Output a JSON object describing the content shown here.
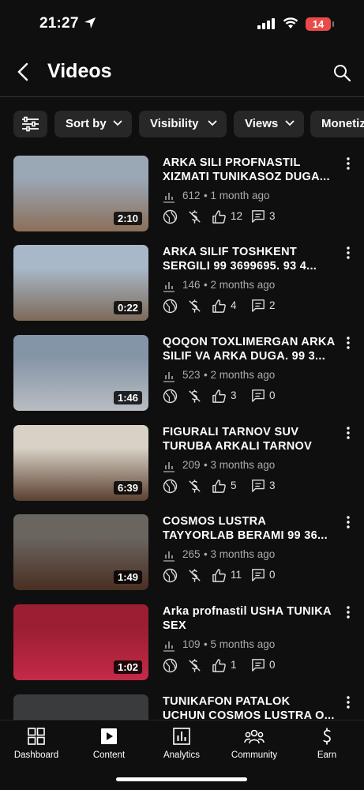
{
  "status": {
    "time": "21:27",
    "battery": "14"
  },
  "header": {
    "title": "Videos"
  },
  "filters": [
    {
      "label": "Sort by"
    },
    {
      "label": "Visibility"
    },
    {
      "label": "Views"
    },
    {
      "label": "Monetiz"
    }
  ],
  "videos": [
    {
      "title": "ARKA SILI PROFNASTIL\nXIZMATI TUNIKASOZ DUGA...",
      "duration": "2:10",
      "views": "612",
      "age": "1 month ago",
      "likes": "12",
      "comments": "3",
      "thumb_colors": [
        "#9aa7b5",
        "#8c6f5a"
      ]
    },
    {
      "title": "ARKA SILIF TOSHKENT\nSERGILI 99 3699695. 93 4...",
      "duration": "0:22",
      "views": "146",
      "age": "2 months ago",
      "likes": "4",
      "comments": "2",
      "thumb_colors": [
        "#a9b8c9",
        "#7d6a58"
      ]
    },
    {
      "title": "QOQON TOXLIMERGAN ARKA\nSILIF VA ARKA DUGA. 99 3...",
      "duration": "1:46",
      "views": "523",
      "age": "2 months ago",
      "likes": "3",
      "comments": "0",
      "thumb_colors": [
        "#8595a8",
        "#b9bdc2"
      ]
    },
    {
      "title": "FIGURALI TARNOV SUV\nTURUBA ARKALI TARNOV",
      "duration": "6:39",
      "views": "209",
      "age": "3 months ago",
      "likes": "5",
      "comments": "3",
      "thumb_colors": [
        "#d8d2c6",
        "#5a4030"
      ]
    },
    {
      "title": "COSMOS LUSTRA\nTAYYORLAB BERAMI 99 36...",
      "duration": "1:49",
      "views": "265",
      "age": "3 months ago",
      "likes": "11",
      "comments": "0",
      "thumb_colors": [
        "#6b6560",
        "#4a2e22"
      ]
    },
    {
      "title": "Arka profnastil USHA TUNIKA\nSEX",
      "duration": "1:02",
      "views": "109",
      "age": "5 months ago",
      "likes": "1",
      "comments": "0",
      "thumb_colors": [
        "#9b1e33",
        "#c42a47"
      ]
    },
    {
      "title": "TUNIKAFON PATALOK\nUCHUN COSMOS LUSTRA O...",
      "duration": "",
      "views": "",
      "age": "",
      "likes": "",
      "comments": "",
      "thumb_colors": [
        "#3a3b3c",
        "#b5944a"
      ]
    }
  ],
  "nav": [
    {
      "label": "Dashboard",
      "icon": "dashboard-icon"
    },
    {
      "label": "Content",
      "icon": "content-icon"
    },
    {
      "label": "Analytics",
      "icon": "analytics-icon"
    },
    {
      "label": "Community",
      "icon": "community-icon"
    },
    {
      "label": "Earn",
      "icon": "earn-icon"
    }
  ]
}
